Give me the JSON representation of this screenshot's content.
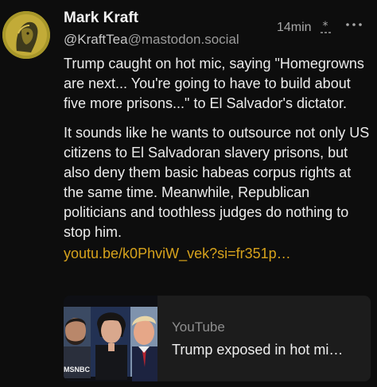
{
  "author": {
    "display_name": "Mark Kraft",
    "handle_local": "@KraftTea",
    "handle_domain": "@mastodon.social"
  },
  "meta": {
    "timestamp": "14min",
    "visibility_icon": "unlisted-icon",
    "more_icon": "more-icon"
  },
  "content": {
    "paragraph_1": "Trump caught on hot mic, saying \"Homegrowns are next... You're going to have to build about five more prisons...\" to El Salvador's dictator.",
    "paragraph_2": "It sounds like he wants to outsource not only US citizens to El Salvadoran slavery prisons, but also deny them basic habeas corpus rights at the same time. Meanwhile, Republican politicians and toothless judges do nothing to stop him.",
    "link_text": "youtu.be/k0PhviW_vek?si=fr351p…"
  },
  "link_card": {
    "provider": "YouTube",
    "title": "Trump exposed in hot mi…",
    "thumbnail_watermark": "MSNBC"
  },
  "colors": {
    "background": "#0d0d0d",
    "link": "#d6a21c",
    "muted": "#9c9c9c"
  }
}
